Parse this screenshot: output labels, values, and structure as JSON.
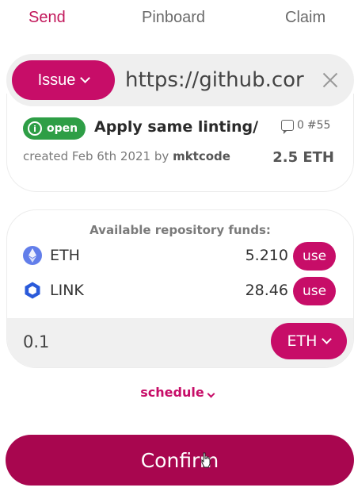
{
  "tabs": [
    {
      "label": "Send",
      "active": true
    },
    {
      "label": "Pinboard",
      "active": false
    },
    {
      "label": "Claim",
      "active": false
    }
  ],
  "url_bar": {
    "type_button": "Issue",
    "url_value": "https://github.cor",
    "clear_icon": "close-icon"
  },
  "issue": {
    "status": "open",
    "title": "Apply same linting/",
    "comments": "0",
    "number": "#55",
    "created_prefix": "created Feb 6th 2021 by",
    "author": "mktcode",
    "bounty": "2.5 ETH"
  },
  "funds": {
    "title": "Available repository funds:",
    "tokens": [
      {
        "name": "ETH",
        "amount": "5.210",
        "button": "use",
        "icon": "ethereum-icon"
      },
      {
        "name": "LINK",
        "amount": "28.46",
        "button": "use",
        "icon": "chainlink-icon"
      }
    ],
    "amount_value": "0.1",
    "currency": "ETH"
  },
  "schedule_label": "schedule",
  "confirm_label": "Confirm",
  "colors": {
    "accent": "#c70d68",
    "confirm": "#a8064f",
    "open_badge": "#2e9e46"
  }
}
